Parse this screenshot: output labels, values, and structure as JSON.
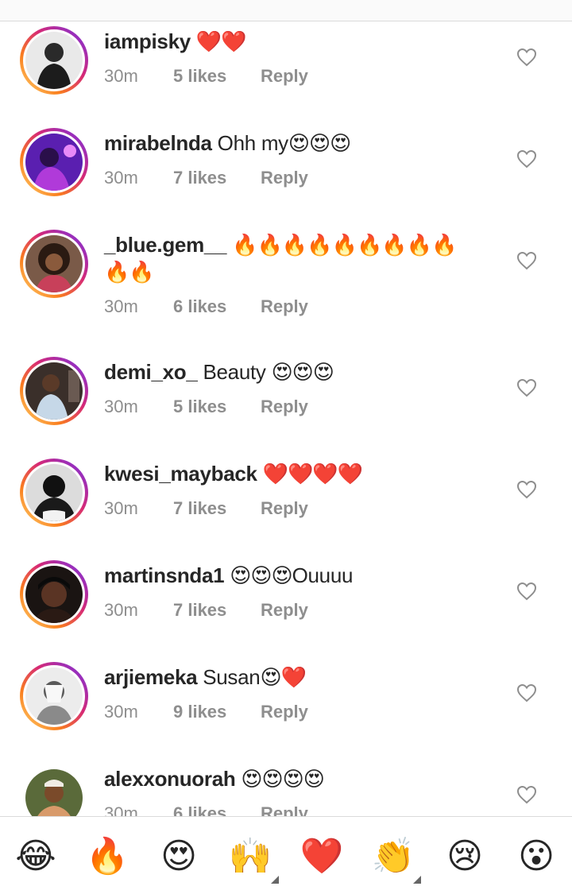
{
  "comments": [
    {
      "username": "iampisky",
      "text": "",
      "emoji": "❤️❤️",
      "time": "30m",
      "likes": "5 likes",
      "reply": "Reply",
      "avatar_color": "#b9b9b9"
    },
    {
      "username": "mirabelnda",
      "text": "Ohh my",
      "emoji": "😍😍😍",
      "time": "30m",
      "likes": "7 likes",
      "reply": "Reply",
      "avatar_color": "#7b2bd9"
    },
    {
      "username": "_blue.gem__",
      "text": "",
      "emoji": "🔥🔥🔥🔥🔥🔥🔥🔥🔥",
      "emoji2": "🔥🔥",
      "time": "30m",
      "likes": "6 likes",
      "reply": "Reply",
      "avatar_color": "#5a3a2a"
    },
    {
      "username": "demi_xo_",
      "text": "Beauty",
      "emoji": "😍😍😍",
      "time": "30m",
      "likes": "5 likes",
      "reply": "Reply",
      "avatar_color": "#3a2a26"
    },
    {
      "username": "kwesi_mayback",
      "text": "",
      "emoji": "❤️❤️❤️❤️",
      "time": "30m",
      "likes": "7 likes",
      "reply": "Reply",
      "avatar_color": "#222222"
    },
    {
      "username": "martinsnda1",
      "text": "Ouuuu",
      "emoji": "😍😍😍",
      "time": "30m",
      "likes": "7 likes",
      "reply": "Reply",
      "avatar_color": "#2a1a14"
    },
    {
      "username": "arjiemeka",
      "text": "Susan",
      "emoji": "😍❤️",
      "time": "30m",
      "likes": "9 likes",
      "reply": "Reply",
      "avatar_color": "#d8d8d8"
    },
    {
      "username": "alexxonuorah",
      "text": "",
      "emoji": "😍😍😍😍",
      "time": "30m",
      "likes": "6 likes",
      "reply": "Reply",
      "avatar_color": "#b7865a"
    }
  ],
  "emoji_bar": [
    "😂",
    "🔥",
    "😍",
    "🙌",
    "❤️",
    "👏",
    "😢",
    "😮"
  ],
  "icons": {
    "like": "heart-outline-icon"
  }
}
